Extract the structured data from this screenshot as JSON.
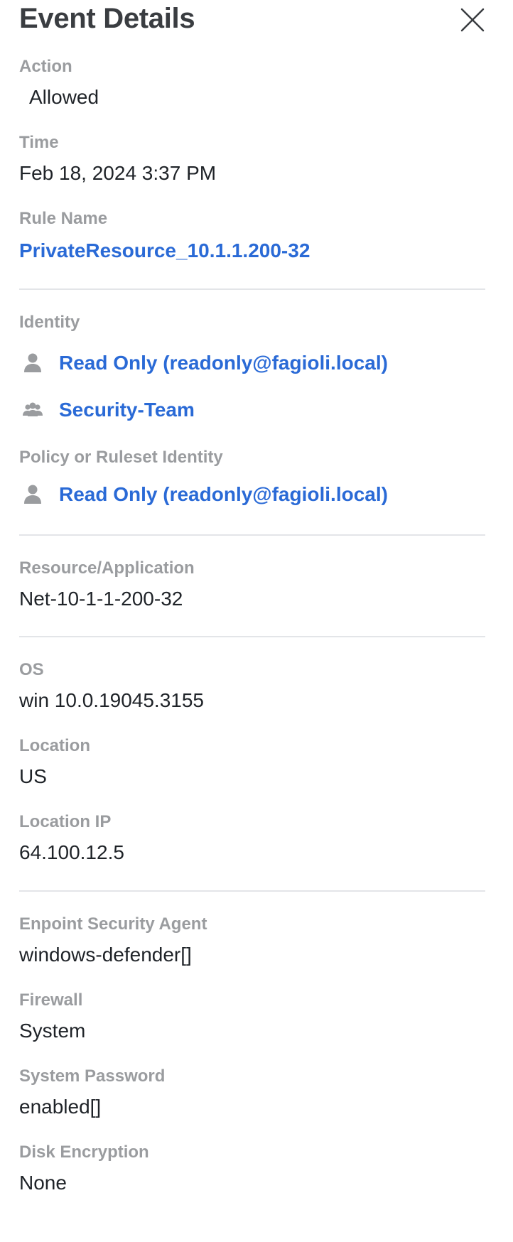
{
  "header": {
    "title": "Event Details"
  },
  "fields": {
    "action": {
      "label": "Action",
      "value": "Allowed"
    },
    "time": {
      "label": "Time",
      "value": "Feb 18, 2024 3:37 PM"
    },
    "rule_name": {
      "label": "Rule Name",
      "value": "PrivateResource_10.1.1.200-32"
    },
    "identity": {
      "label": "Identity",
      "items": [
        {
          "icon": "user-icon",
          "value": "Read Only (readonly@fagioli.local)"
        },
        {
          "icon": "group-icon",
          "value": "Security-Team"
        }
      ]
    },
    "policy_identity": {
      "label": "Policy or Ruleset Identity",
      "items": [
        {
          "icon": "user-icon",
          "value": "Read Only (readonly@fagioli.local)"
        }
      ]
    },
    "resource": {
      "label": "Resource/Application",
      "value": "Net-10-1-1-200-32"
    },
    "os": {
      "label": "OS",
      "value": "win 10.0.19045.3155"
    },
    "location": {
      "label": "Location",
      "value": "US"
    },
    "location_ip": {
      "label": "Location IP",
      "value": "64.100.12.5"
    },
    "endpoint_agent": {
      "label": "Enpoint Security Agent",
      "value": "windows-defender[]"
    },
    "firewall": {
      "label": "Firewall",
      "value": "System"
    },
    "system_password": {
      "label": "System Password",
      "value": "enabled[]"
    },
    "disk_encryption": {
      "label": "Disk Encryption",
      "value": "None"
    }
  },
  "colors": {
    "label": "#9a9c9f",
    "link": "#2a6ad6",
    "text": "#1f2328",
    "divider": "#e3e5e8",
    "icon": "#9a9c9f"
  }
}
